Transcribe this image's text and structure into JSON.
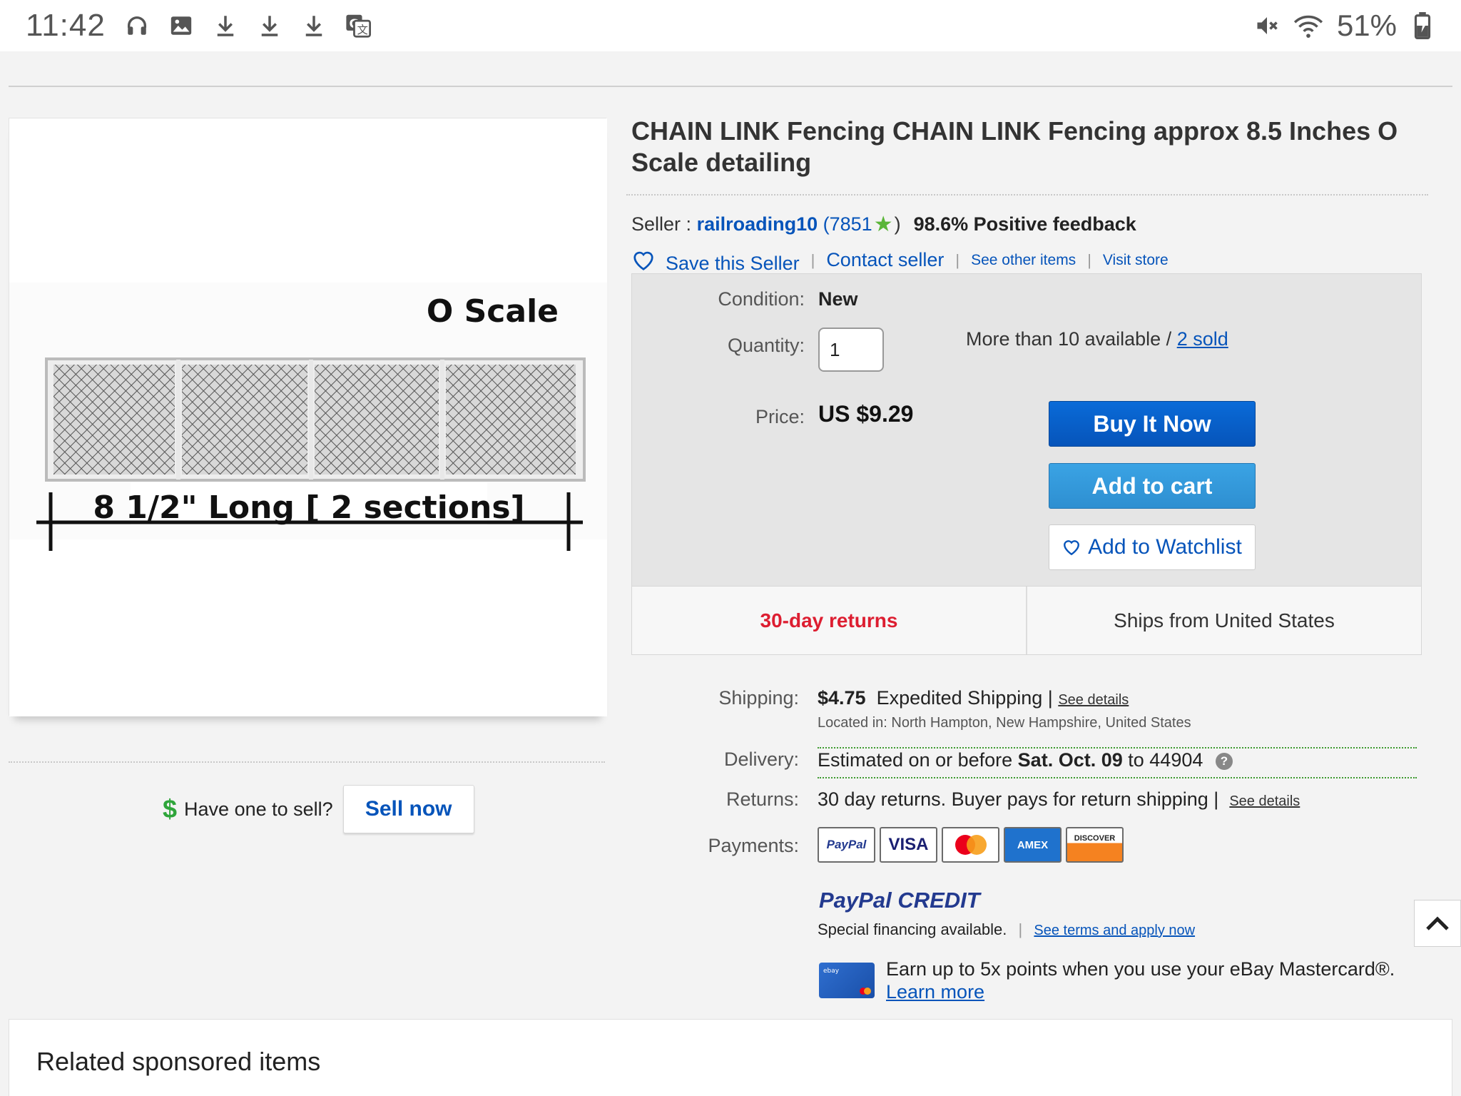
{
  "status_bar": {
    "time": "11:42",
    "battery": "51%",
    "left_icons": [
      "headphones-icon",
      "image-icon",
      "download-icon",
      "download-icon",
      "download-icon",
      "translate-icon"
    ],
    "right_icons": [
      "mute-icon",
      "wifi-icon",
      "battery-charging-icon"
    ]
  },
  "product_image": {
    "label_top": "O Scale",
    "label_bottom": "8 1/2\" Long [ 2 sections]"
  },
  "sell": {
    "prompt": "Have one to sell?",
    "button": "Sell now"
  },
  "listing": {
    "title": "CHAIN LINK Fencing CHAIN LINK Fencing approx 8.5 Inches O Scale detailing",
    "seller_label": "Seller :",
    "seller_name": "railroading10",
    "feedback_count": "7851",
    "positive_feedback": "98.6% Positive feedback",
    "save_seller": "Save this Seller",
    "contact_seller": "Contact seller",
    "see_other_items": "See other items",
    "visit_store": "Visit store"
  },
  "buy_box": {
    "condition_label": "Condition:",
    "condition_value": "New",
    "quantity_label": "Quantity:",
    "quantity_value": "1",
    "availability": "More than 10 available /",
    "sold_link": "2 sold",
    "price_label": "Price:",
    "price_value": "US $9.29",
    "buy_now": "Buy It Now",
    "add_to_cart": "Add to cart",
    "add_to_watchlist": "Add to Watchlist",
    "returns_badge": "30-day returns",
    "ships_from": "Ships from United States"
  },
  "details": {
    "shipping_label": "Shipping:",
    "shipping_price": "$4.75",
    "shipping_method": "Expedited Shipping |",
    "shipping_see_details": "See details",
    "located_in": "Located in:  North Hampton, New Hampshire, United States",
    "delivery_label": "Delivery:",
    "delivery_prefix": "Estimated on or before",
    "delivery_date": "Sat. Oct. 09",
    "delivery_suffix": "to 44904",
    "returns_label": "Returns:",
    "returns_text": "30 day returns. Buyer pays for return shipping |",
    "returns_see_details": "See details",
    "payments_label": "Payments:",
    "payment_methods": [
      "PayPal",
      "VISA",
      "Mastercard",
      "AMEX",
      "DISCOVER"
    ]
  },
  "paypal_credit": {
    "brand_pay": "PayPal",
    "brand_credit": "CREDIT",
    "special": "Special financing available.",
    "terms_link": "See terms and apply now"
  },
  "mastercard_promo": {
    "text": "Earn up to 5x points when you use your eBay Mastercard®.",
    "link": "Learn more"
  },
  "related": {
    "title": "Related sponsored items"
  },
  "colors": {
    "ebay_blue": "#0654ba",
    "returns_red": "#dd1e31",
    "delivery_green": "#3d9a2f"
  }
}
